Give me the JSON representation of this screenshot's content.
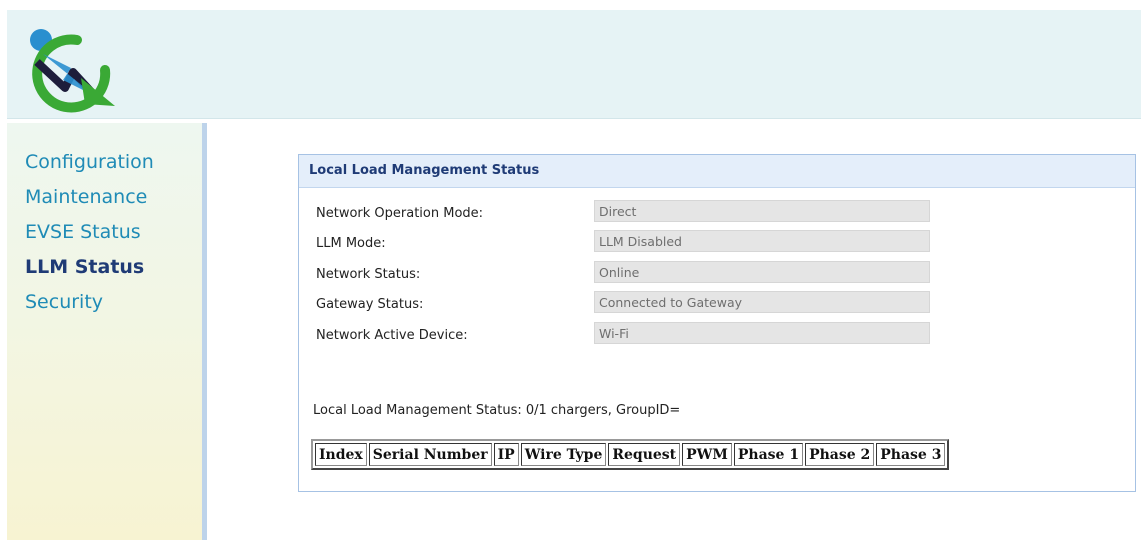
{
  "sidebar": {
    "items": [
      {
        "label": "Configuration"
      },
      {
        "label": "Maintenance"
      },
      {
        "label": "EVSE Status"
      },
      {
        "label": "LLM Status"
      },
      {
        "label": "Security"
      }
    ],
    "active_index": 3
  },
  "panel": {
    "title": "Local Load Management Status",
    "rows": [
      {
        "label": "Network Operation Mode:",
        "value": "Direct"
      },
      {
        "label": "LLM Mode:",
        "value": "LLM Disabled"
      },
      {
        "label": "Network Status:",
        "value": "Online"
      },
      {
        "label": "Gateway Status:",
        "value": "Connected to Gateway"
      },
      {
        "label": "Network Active Device:",
        "value": "Wi-Fi"
      }
    ],
    "summary": "Local Load Management Status: 0/1 chargers, GroupID=",
    "table": {
      "headers": [
        "Index",
        "Serial Number",
        "IP",
        "Wire Type",
        "Request",
        "PWM",
        "Phase 1",
        "Phase 2",
        "Phase 3"
      ],
      "rows": []
    }
  },
  "colors": {
    "header_bg": "#e6f3f5",
    "nav_link": "#1f8bb6",
    "nav_active": "#1f3b76",
    "panel_border": "#a6c2e4",
    "logo_green": "#3aa935",
    "logo_blue": "#2a8fcf"
  },
  "icons": {
    "logo": "brand-logo-icon"
  }
}
